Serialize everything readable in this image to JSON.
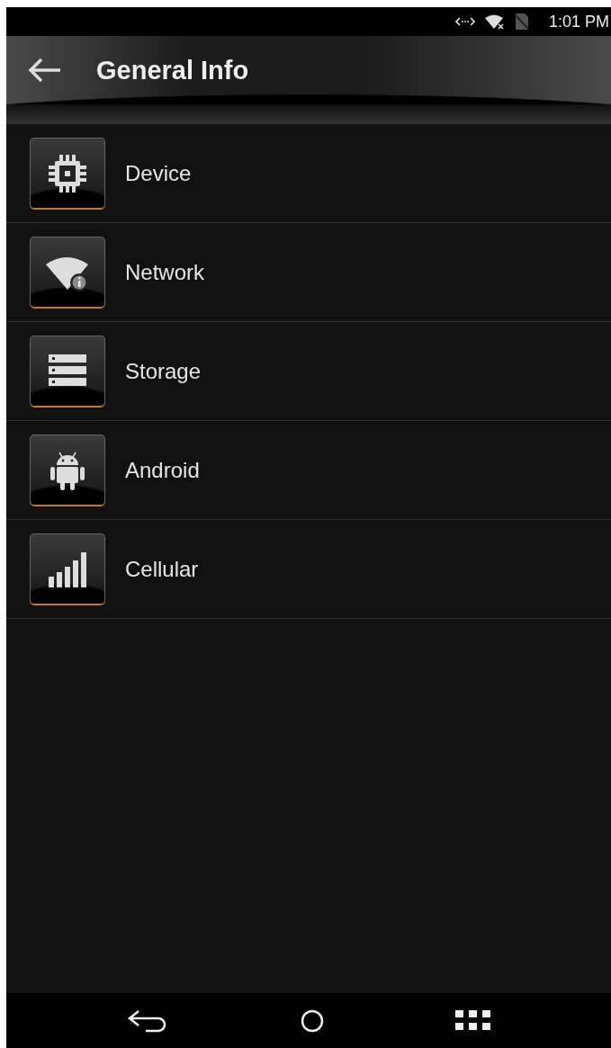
{
  "status_bar": {
    "time": "1:01 PM"
  },
  "header": {
    "title": "General Info"
  },
  "items": [
    {
      "label": "Device",
      "kind": "chip"
    },
    {
      "label": "Network",
      "kind": "wifi"
    },
    {
      "label": "Storage",
      "kind": "storage"
    },
    {
      "label": "Android",
      "kind": "android"
    },
    {
      "label": "Cellular",
      "kind": "signal"
    }
  ]
}
